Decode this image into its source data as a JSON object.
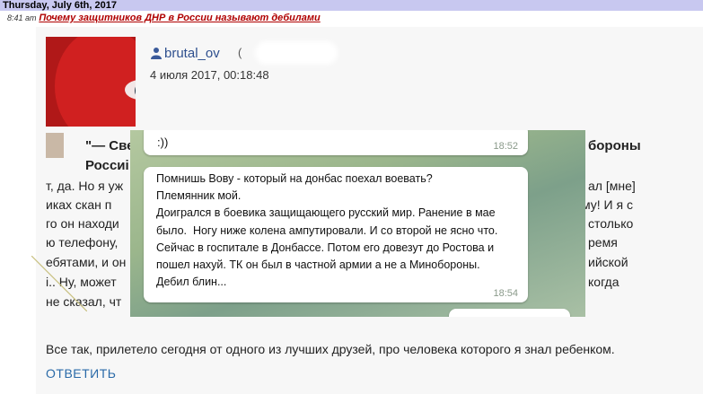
{
  "date_header": "Thursday, July 6th, 2017",
  "post": {
    "time": "8:41 am",
    "title": "Почему защитников ДНР в России называют дебилами"
  },
  "author": {
    "username": "brutal_ov",
    "handle_prefix": "(",
    "date": "4 июля 2017, 00:18:48"
  },
  "quote": {
    "title_part1": "\"— Све",
    "title_part2": "бороны",
    "title_line2": "Россиі"
  },
  "background_text": [
    {
      "left": "т, да. Но я уж",
      "right": "ал [мне]"
    },
    {
      "left": "иках скан п",
      "right": "му! И я с"
    },
    {
      "left": "го он находи",
      "right": "столько"
    },
    {
      "left": "ю телефону,",
      "right": "ремя"
    },
    {
      "left": "ебятами, и он",
      "right": "ийской"
    },
    {
      "left": "і.. Ну, может",
      "right": "когда"
    },
    {
      "left": "не сказал, чт",
      "right": ""
    }
  ],
  "chat": {
    "msg1_text": ":))",
    "msg1_time": "18:52",
    "msg2_text": "Помнишь Вову - который на донбас поехал воевать?\nПлемянник мой.\nДоигрался в боевика защищающего русский мир. Ранение в мае было.  Ногу ниже колена ампутировали. И со второй не ясно что.\nСейчас в госпитале в Донбассе. Потом его довезут до Ростова и пошел нахуй. ТК он был в частной армии а не а Минобороны.\nДебил блин...",
    "msg2_time": "18:54"
  },
  "footer_text": "Все так, прилетело сегодня от одного из лучших друзей, про человека которого я знал ребенком.",
  "reply_label": "ОТВЕТИТЬ",
  "colors": {
    "date_bar": "#c8c8f0",
    "link": "#b00000",
    "username": "#2e4f8e",
    "reply": "#2a6aa8"
  }
}
